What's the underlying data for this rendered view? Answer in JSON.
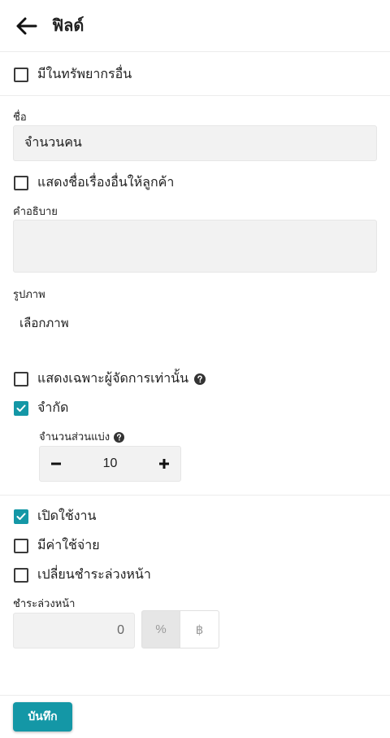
{
  "header": {
    "title": "ฟิลด์",
    "back_icon": "arrow-left-icon"
  },
  "other_resource": {
    "label": "มีในทรัพยากรอื่น",
    "checked": false
  },
  "name": {
    "label": "ชื่อ",
    "value": "จำนวนคน"
  },
  "show_other_name": {
    "label": "แสดงชื่อเรื่องอื่นให้ลูกค้า",
    "checked": false
  },
  "description": {
    "label": "คำอธิบาย",
    "value": ""
  },
  "image": {
    "label": "รูปภาพ",
    "choose_label": "เลือกภาพ"
  },
  "admin_only": {
    "label": "แสดงเฉพาะผู้จัดการเท่านั้น",
    "checked": false,
    "help_icon": "question-circle-icon"
  },
  "limit": {
    "label": "จำกัด",
    "checked": true,
    "quantity_label": "จำนวนส่วนแบ่ง",
    "quantity_help_icon": "question-circle-icon",
    "value": "10",
    "minus_icon": "minus-icon",
    "plus_icon": "plus-icon"
  },
  "enabled": {
    "label": "เปิดใช้งาน",
    "checked": true
  },
  "has_cost": {
    "label": "มีค่าใช้จ่าย",
    "checked": false
  },
  "change_prepay": {
    "label": "เปลี่ยนชำระล่วงหน้า",
    "checked": false
  },
  "prepay": {
    "label": "ชำระล่วงหน้า",
    "value": "0",
    "unit_percent": "%",
    "unit_baht": "฿",
    "selected_unit": "%"
  },
  "footer": {
    "save_label": "บันทึก"
  },
  "colors": {
    "accent": "#1497a6",
    "input_bg": "#f2f2f2",
    "border": "#ececec"
  }
}
